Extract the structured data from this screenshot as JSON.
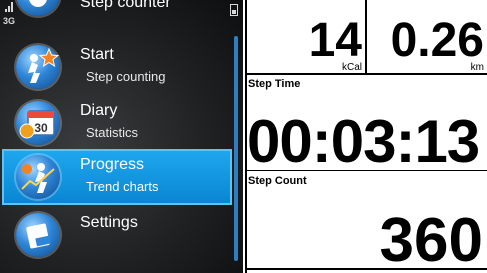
{
  "app": {
    "title": "Step counter"
  },
  "status": {
    "network": "3G"
  },
  "menu": [
    {
      "id": "start",
      "title": "Start",
      "subtitle": "Step counting",
      "icon": "runner-star-icon",
      "selected": false
    },
    {
      "id": "diary",
      "title": "Diary",
      "subtitle": "Statistics",
      "icon": "calendar-30-icon",
      "selected": false
    },
    {
      "id": "progress",
      "title": "Progress",
      "subtitle": "Trend charts",
      "icon": "runner-trend-icon",
      "selected": true
    },
    {
      "id": "settings",
      "title": "Settings",
      "subtitle": "",
      "icon": "settings-card-icon",
      "selected": false
    }
  ],
  "calendar_day": "30",
  "stats": {
    "calories": {
      "value": "14",
      "unit": "kCal"
    },
    "distance": {
      "value": "0.26",
      "unit": "km"
    },
    "step_time": {
      "label": "Step Time",
      "value": "00:03:13"
    },
    "step_count": {
      "label": "Step Count",
      "value": "360"
    }
  },
  "colors": {
    "accent": "#0a86d2",
    "panel_bg": "#1f2122",
    "text_dark": "#000000"
  }
}
